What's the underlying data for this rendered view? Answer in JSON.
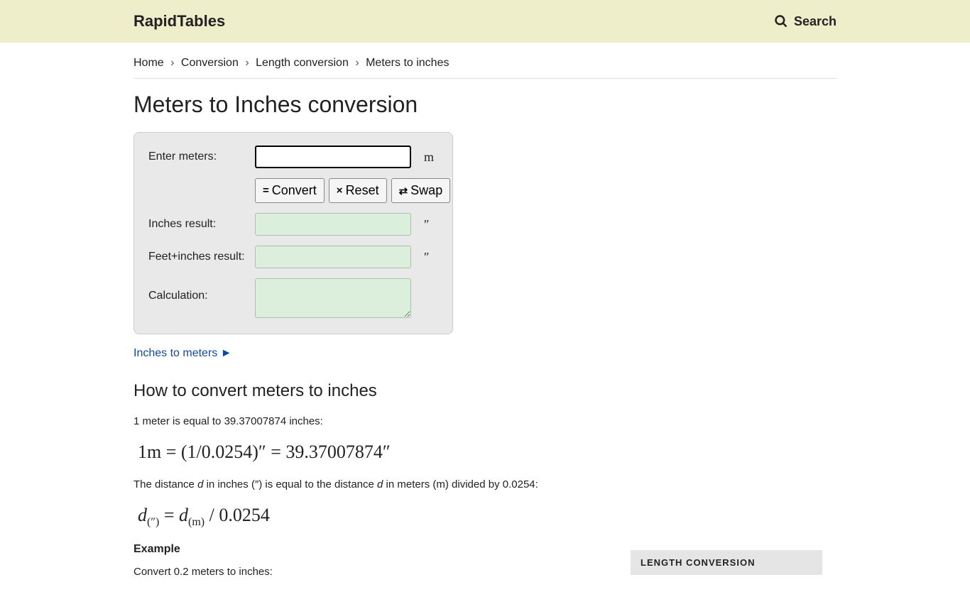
{
  "header": {
    "logo": "RapidTables",
    "search_label": "Search"
  },
  "breadcrumb": {
    "items": [
      "Home",
      "Conversion",
      "Length conversion",
      "Meters to inches"
    ]
  },
  "title": "Meters to Inches conversion",
  "calc": {
    "enter_label": "Enter meters:",
    "enter_unit": "m",
    "convert_btn": "Convert",
    "reset_btn": "Reset",
    "swap_btn": "Swap",
    "inches_label": "Inches result:",
    "inches_unit": "″",
    "feetinches_label": "Feet+inches result:",
    "feetinches_unit": "″",
    "calc_label": "Calculation:"
  },
  "reverse_link": "Inches to meters ►",
  "howto_heading": "How to convert meters to inches",
  "howto_p1": "1 meter is equal to 39.37007874 inches:",
  "formula1": "1m = (1/0.0254)″ = 39.37007874″",
  "howto_p2_pre": "The distance ",
  "howto_p2_mid1": " in inches (″) is equal to the distance ",
  "howto_p2_mid2": " in meters (m) divided by 0.0254:",
  "formula2_lhs_var": "d",
  "formula2_lhs_sub": "(″)",
  "formula2_eq": " = ",
  "formula2_rhs_var": "d",
  "formula2_rhs_sub": "(m)",
  "formula2_tail": " / 0.0254",
  "example_h": "Example",
  "example_p": "Convert 0.2 meters to inches:",
  "sidebar_title": "LENGTH CONVERSION"
}
